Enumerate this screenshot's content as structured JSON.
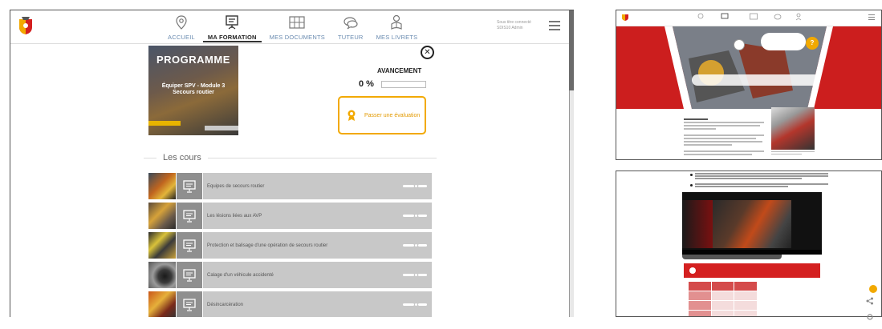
{
  "nav": {
    "items": [
      {
        "label": "ACCUEIL",
        "icon": "map-pin-icon",
        "active": false
      },
      {
        "label": "MA FORMATION",
        "icon": "presentation-icon",
        "active": true
      },
      {
        "label": "MES DOCUMENTS",
        "icon": "documents-grid-icon",
        "active": false
      },
      {
        "label": "TUTEUR",
        "icon": "chat-bubbles-icon",
        "active": false
      },
      {
        "label": "MES LIVRETS",
        "icon": "user-with-book-icon",
        "active": false
      }
    ]
  },
  "user": {
    "line1": "Sous titre connecté",
    "line2": "SDIS10 Admin"
  },
  "program": {
    "badge": "PROGRAMME",
    "subtitle": "Équiper SPV - Module 3\nSecours routier"
  },
  "progress": {
    "label": "AVANCEMENT",
    "value": "0 %",
    "fraction": 0
  },
  "evaluation": {
    "label": "Passer une évaluation"
  },
  "courses_section": {
    "title": "Les cours"
  },
  "courses": [
    {
      "title": "Equipes de secours routier",
      "progress": 0
    },
    {
      "title": "Les lésions liées aux AVP",
      "progress": 0
    },
    {
      "title": "Protection et balisage d'une opération de secours routier",
      "progress": 0
    },
    {
      "title": "Calage d'un véhicule accidenté",
      "progress": 0
    },
    {
      "title": "Désincarcération",
      "progress": 0
    }
  ],
  "colors": {
    "accent": "#f2a900",
    "brand_red": "#cc1e1e",
    "course_row": "#c8c8c8",
    "course_icon_bg": "#8f8f8f",
    "nav_inactive": "#6a8bb0"
  }
}
